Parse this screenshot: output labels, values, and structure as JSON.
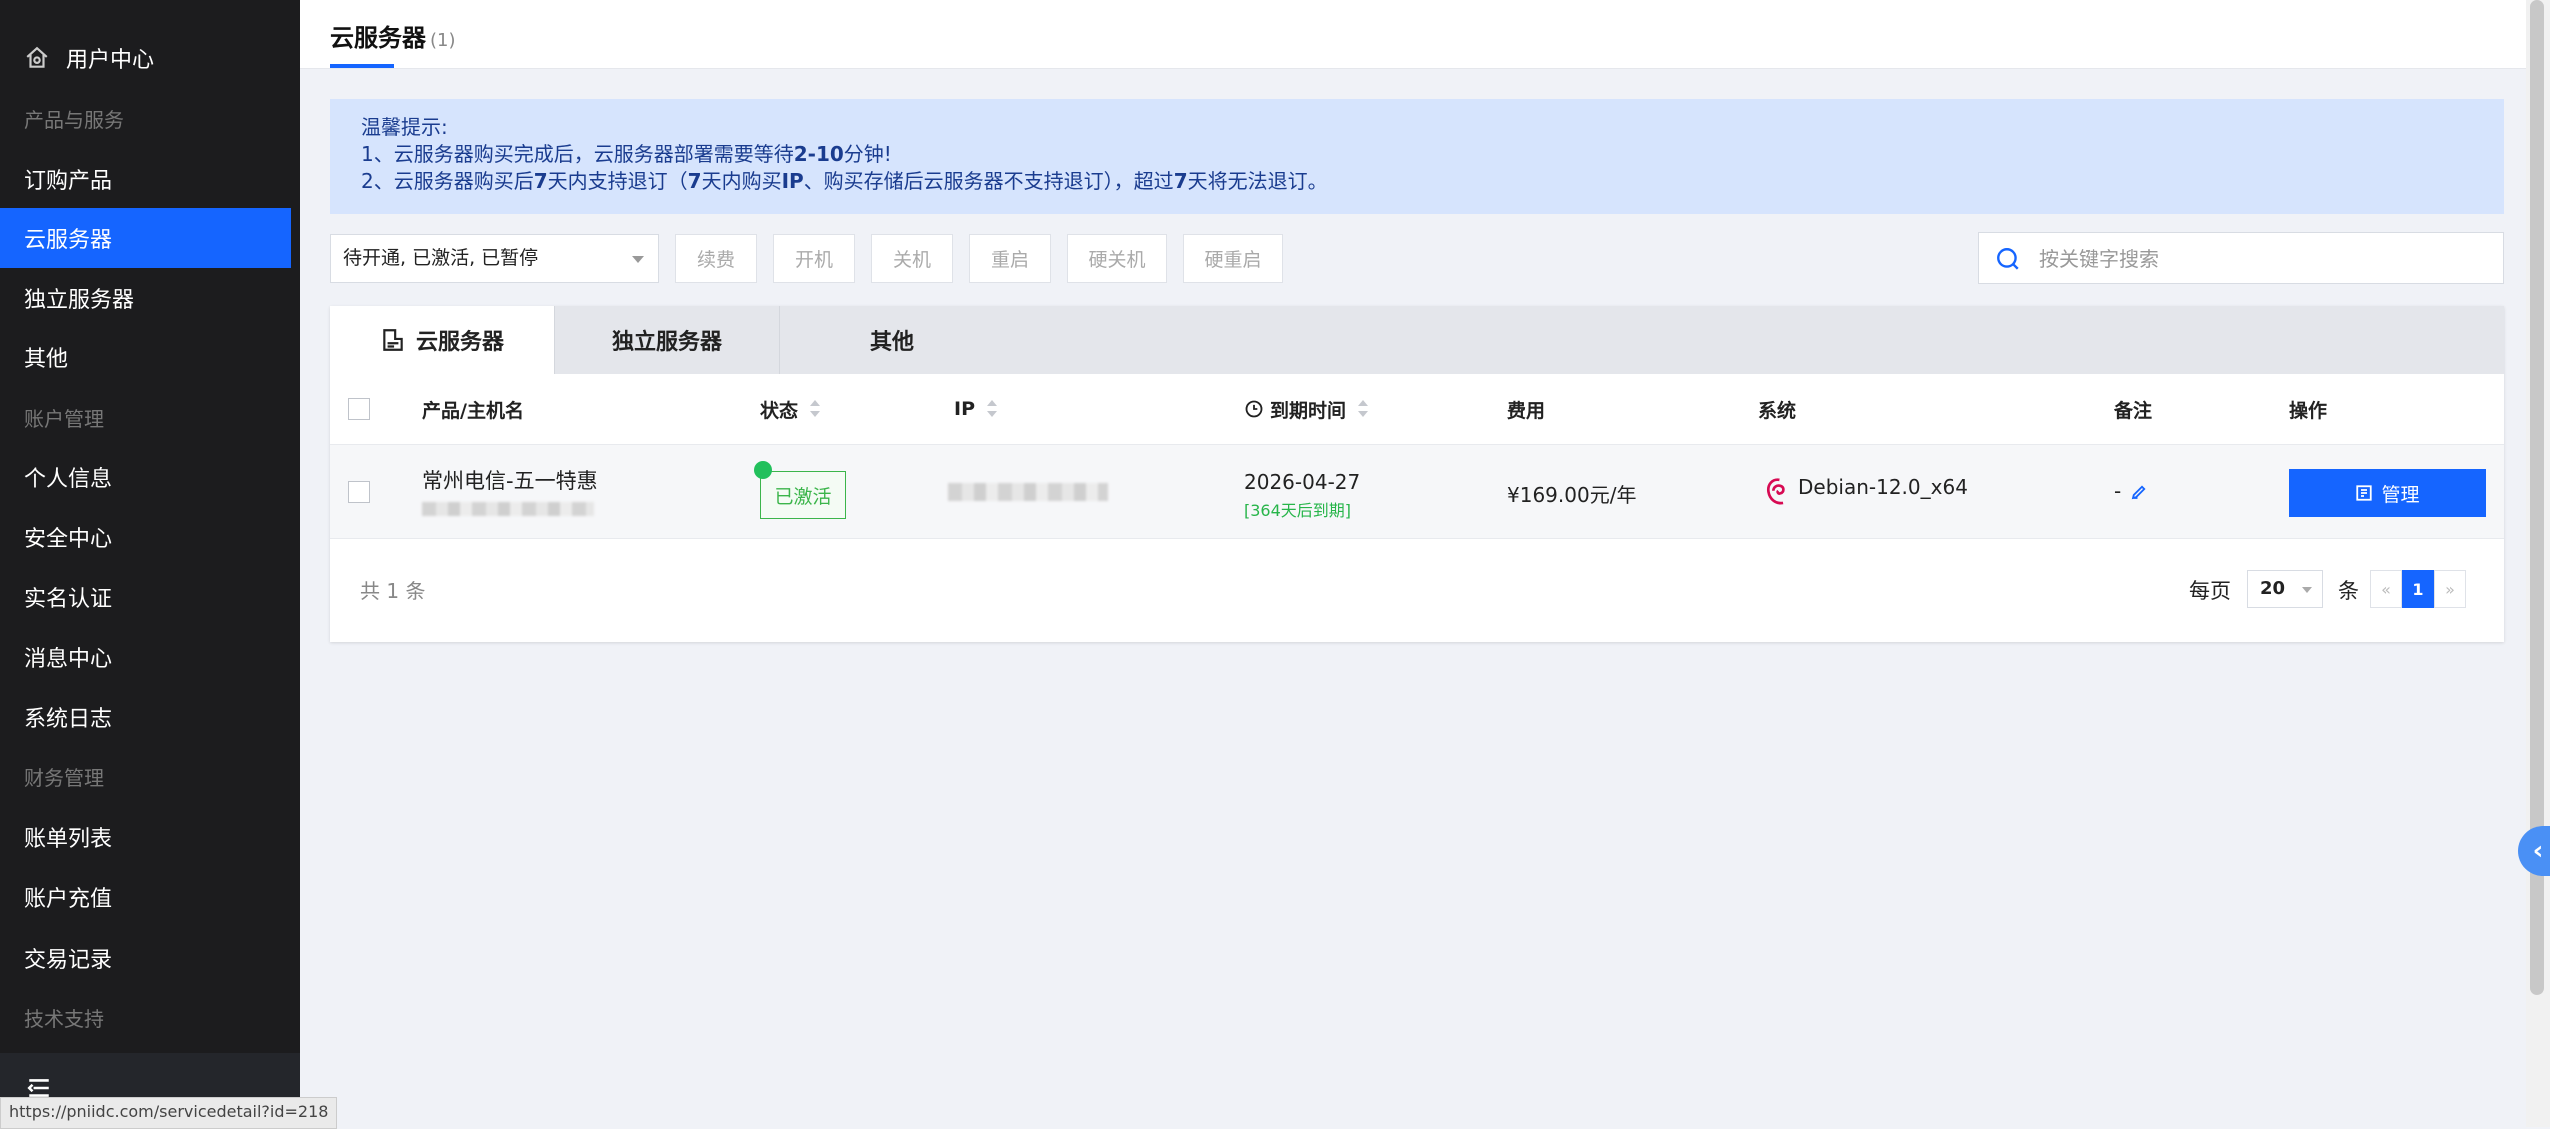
{
  "sidebar": {
    "user_center": "用户中心",
    "groups": {
      "products": "产品与服务",
      "account": "账户管理",
      "finance": "财务管理",
      "support": "技术支持"
    },
    "items": {
      "order": "订购产品",
      "cloud_server": "云服务器",
      "dedicated_server": "独立服务器",
      "other": "其他",
      "profile": "个人信息",
      "security": "安全中心",
      "realname": "实名认证",
      "messages": "消息中心",
      "syslog": "系统日志",
      "bills": "账单列表",
      "recharge": "账户充值",
      "transactions": "交易记录"
    }
  },
  "statusbar": {
    "url": "https://pniidc.com/servicedetail?id=218"
  },
  "page": {
    "title": "云服务器",
    "count": "(1)"
  },
  "notice": {
    "heading": "温馨提示:",
    "line1_a": "1、云服务器购买完成后，云服务器部署需要等待",
    "line1_b": "2-10",
    "line1_c": "分钟!",
    "line2_a": "2、云服务器购买后",
    "line2_b": "7",
    "line2_c": "天内支持退订（",
    "line2_d": "7",
    "line2_e": "天内购买",
    "line2_f": "IP",
    "line2_g": "、购买存储后云服务器不支持退订），超过",
    "line2_h": "7",
    "line2_i": "天将无法退订。"
  },
  "toolbar": {
    "filter_value": "待开通, 已激活, 已暂停",
    "renew": "续费",
    "power_on": "开机",
    "power_off": "关机",
    "reboot": "重启",
    "hard_off": "硬关机",
    "hard_reboot": "硬重启",
    "search_placeholder": "按关键字搜索"
  },
  "tabs": [
    "云服务器",
    "独立服务器",
    "其他"
  ],
  "table": {
    "headers": {
      "product": "产品/主机名",
      "status": "状态",
      "ip": "IP",
      "expiry": "到期时间",
      "cost": "费用",
      "system": "系统",
      "remark": "备注",
      "action": "操作"
    },
    "rows": [
      {
        "product": "常州电信-五一特惠",
        "status": "已激活",
        "expiry_date": "2026-04-27",
        "expiry_note": "[364天后到期]",
        "cost": "¥169.00元/年",
        "system": "Debian-12.0_x64",
        "remark": "-",
        "action": "管理"
      }
    ]
  },
  "footer": {
    "total": "共 1 条",
    "per_page": "每页",
    "page_size": "20",
    "unit": "条",
    "prev": "«",
    "current_page": "1",
    "next": "»"
  },
  "colors": {
    "accent": "#1565ff",
    "sidebar_bg": "#1c1c1e",
    "success": "#3bb54a",
    "notice_bg": "#d6e4fd"
  },
  "side_handle": "‹"
}
